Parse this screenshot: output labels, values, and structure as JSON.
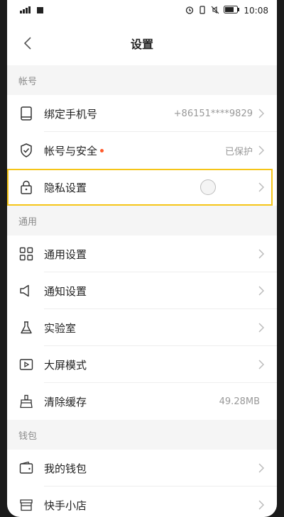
{
  "statusbar": {
    "time": "10:08"
  },
  "header": {
    "title": "设置"
  },
  "sections": {
    "account": {
      "label": "帐号"
    },
    "general": {
      "label": "通用"
    },
    "wallet": {
      "label": "钱包"
    }
  },
  "rows": {
    "bind_phone": {
      "label": "绑定手机号",
      "value": "+86151****9829",
      "icon": "phone-icon"
    },
    "account_security": {
      "label": "帐号与安全",
      "value": "已保护",
      "icon": "shield-icon"
    },
    "privacy": {
      "label": "隐私设置",
      "icon": "lock-icon"
    },
    "general_settings": {
      "label": "通用设置",
      "icon": "grid-icon"
    },
    "notification": {
      "label": "通知设置",
      "icon": "speaker-icon"
    },
    "lab": {
      "label": "实验室",
      "icon": "flask-icon"
    },
    "big_screen": {
      "label": "大屏模式",
      "icon": "play-screen-icon"
    },
    "clear_cache": {
      "label": "清除缓存",
      "value": "49.28MB",
      "icon": "broom-icon"
    },
    "my_wallet": {
      "label": "我的钱包",
      "icon": "wallet-icon"
    },
    "shop": {
      "label": "快手小店",
      "icon": "store-icon"
    }
  },
  "colors": {
    "accent_highlight": "#f5c518",
    "badge_dot": "#ff5a2b"
  }
}
